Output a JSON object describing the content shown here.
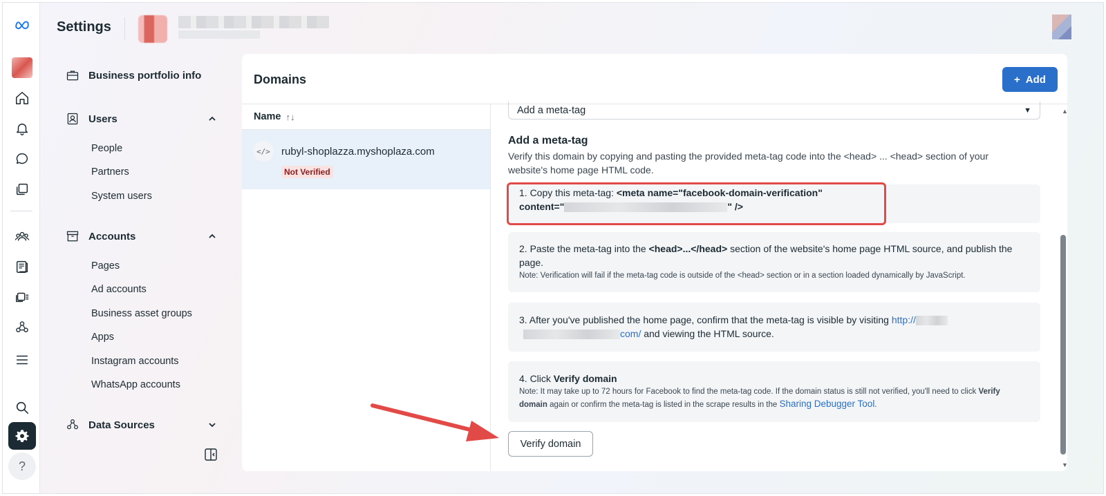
{
  "header": {
    "title": "Settings"
  },
  "nav": {
    "business_info": "Business portfolio info",
    "users": {
      "label": "Users",
      "items": [
        "People",
        "Partners",
        "System users"
      ]
    },
    "accounts": {
      "label": "Accounts",
      "items": [
        "Pages",
        "Ad accounts",
        "Business asset groups",
        "Apps",
        "Instagram accounts",
        "WhatsApp accounts"
      ]
    },
    "data_sources": "Data Sources"
  },
  "main": {
    "title": "Domains",
    "add_label": "Add",
    "list": {
      "column_name": "Name",
      "sort_icon": "sort-icon",
      "rows": [
        {
          "domain": "rubyl-shoplazza.myshoplaza.com",
          "status": "Not Verified"
        }
      ]
    },
    "detail": {
      "method_selected": "Add a meta-tag",
      "section_title": "Add a meta-tag",
      "section_desc": "Verify this domain by copying and pasting the provided meta-tag code into the <head> ... <head> section of your website's home page HTML code.",
      "step1": {
        "prefix": "1. Copy this meta-tag: ",
        "code_a": "<meta name=\"facebook-domain-verification\"",
        "code_b": "content=\"",
        "code_c": "\" />"
      },
      "step2": {
        "prefix": "2. Paste the meta-tag into the ",
        "code": "<head>...</head>",
        "suffix": " section of the website's home page HTML source, and publish the page.",
        "note": "Note: Verification will fail if the meta-tag code is outside of the <head> section or in a section loaded dynamically by JavaScript."
      },
      "step3": {
        "prefix": "3. After you've published the home page, confirm that the meta-tag is visible by visiting ",
        "link_a": "http://",
        "link_b": "com/",
        "suffix": " and viewing the HTML source."
      },
      "step4": {
        "prefix": "4. Click ",
        "bold": "Verify domain",
        "note_a": "Note: It may take up to 72 hours for Facebook to find the meta-tag code. If the domain status is still not verified, you'll need to click ",
        "note_bold": "Verify domain",
        "note_b": " again or confirm the meta-tag is listed in the scrape results in the ",
        "note_link": "Sharing Debugger Tool",
        "note_c": "."
      },
      "verify_button": "Verify domain"
    }
  },
  "colors": {
    "accent": "#2a6fc9",
    "highlight": "#e14a46",
    "badge_bg": "#fbe2e2",
    "badge_text": "#8a1d1d"
  }
}
